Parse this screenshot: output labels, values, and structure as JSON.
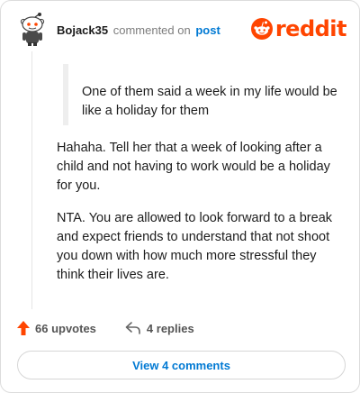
{
  "comment": {
    "username": "Bojack35",
    "action_text": "commented on",
    "post_link": "post",
    "avatar_icon": "snoo-avatar-icon",
    "quote": "One of them said a week in my life would be like a holiday for them",
    "paragraphs": [
      "Hahaha. Tell her that a week of looking after a child and not having to work would be a holiday for you.",
      "NTA. You are allowed to look forward to a break and expect friends to understand that not shoot you down with how much more stressful they think their lives are."
    ]
  },
  "brand": {
    "name": "reddit",
    "icon": "reddit-logo-icon",
    "color": "#ff4500"
  },
  "actions": {
    "upvotes": "66 upvotes",
    "upvote_icon": "upvote-arrow-icon",
    "replies": "4 replies",
    "reply_icon": "reply-arrow-icon"
  },
  "footer": {
    "view_comments": "View 4 comments"
  },
  "colors": {
    "link": "#0079d3",
    "accent": "#ff4500"
  }
}
